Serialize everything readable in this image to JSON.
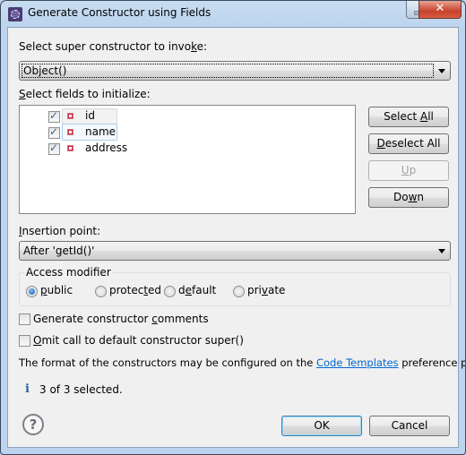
{
  "window": {
    "title": "Generate Constructor using Fields",
    "icon": "gear-icon",
    "controls": {
      "minimize": "minimize-icon",
      "maximize": "maximize-icon",
      "close_glyph": "✕"
    }
  },
  "super_constructor": {
    "label_pre": "Select super constructor to invo",
    "label_mnemonic": "k",
    "label_post": "e:",
    "value": "Object()"
  },
  "fields": {
    "label_mnemonic": "S",
    "label_post": "elect fields to initialize:",
    "items": [
      {
        "name": "id",
        "checked": true
      },
      {
        "name": "name",
        "checked": true
      },
      {
        "name": "address",
        "checked": true
      }
    ]
  },
  "side_buttons": {
    "select_all_pre": "Select ",
    "select_all_mn": "A",
    "select_all_post": "ll",
    "deselect_all_mn": "D",
    "deselect_all_post": "eselect All",
    "up_mn": "U",
    "up_post": "p",
    "down_pre": "Do",
    "down_mn": "w",
    "down_post": "n"
  },
  "insertion": {
    "label_mn": "I",
    "label_post": "nsertion point:",
    "value": "After 'getId()'"
  },
  "access_modifier": {
    "title": "Access modifier",
    "options": [
      {
        "pre": "",
        "mn": "p",
        "post": "ublic",
        "selected": true
      },
      {
        "pre": "protec",
        "mn": "t",
        "post": "ed",
        "selected": false
      },
      {
        "pre": "d",
        "mn": "e",
        "post": "fault",
        "selected": false
      },
      {
        "pre": "pri",
        "mn": "v",
        "post": "ate",
        "selected": false
      }
    ]
  },
  "options": {
    "generate_comments_pre": "Generate constructor ",
    "generate_comments_mn": "c",
    "generate_comments_post": "omments",
    "generate_comments_checked": false,
    "omit_super_mn": "O",
    "omit_super_post": "mit call to default constructor super()",
    "omit_super_checked": false
  },
  "info": {
    "text_pre": "The format of the constructors may be configured on the ",
    "link": "Code Templates",
    "text_post": " preference page.",
    "status_icon": "info-icon",
    "status": "3 of 3 selected."
  },
  "footer": {
    "help_glyph": "?",
    "ok": "OK",
    "cancel": "Cancel"
  }
}
